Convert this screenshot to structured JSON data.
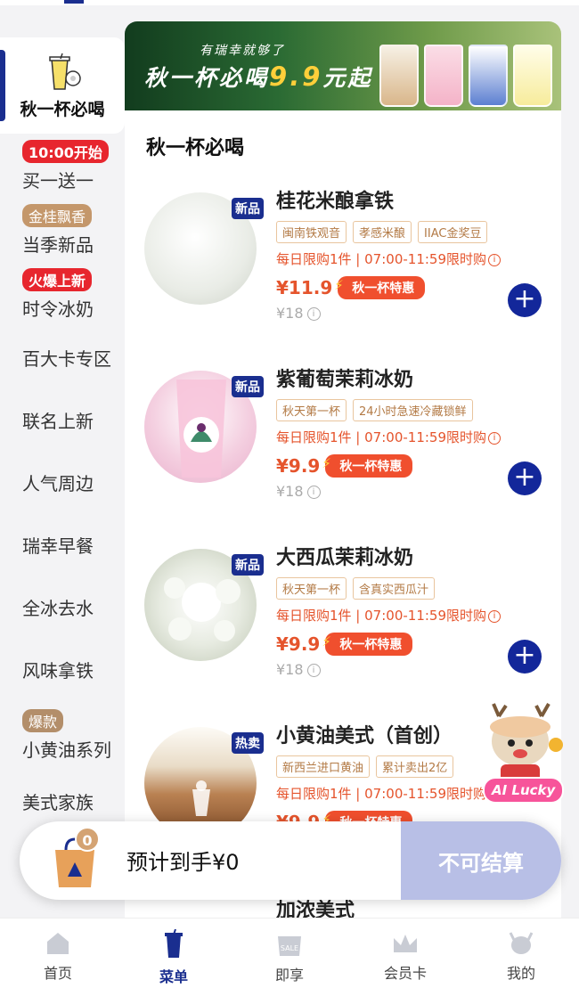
{
  "sidebar": {
    "items": [
      {
        "label": "秋一杯必喝",
        "badge": "",
        "active": true
      },
      {
        "label": "买一送一",
        "badge": "10:00开始",
        "badge_color": "#e7262e"
      },
      {
        "label": "当季新品",
        "badge": "金桂飘香",
        "badge_color": "#c4976b"
      },
      {
        "label": "时令冰奶",
        "badge": "火爆上新",
        "badge_color": "#e7262e"
      },
      {
        "label": "百大卡专区",
        "badge": ""
      },
      {
        "label": "联名上新",
        "badge": ""
      },
      {
        "label": "人气周边",
        "badge": ""
      },
      {
        "label": "瑞幸早餐",
        "badge": ""
      },
      {
        "label": "全冰去水",
        "badge": ""
      },
      {
        "label": "风味拿铁",
        "badge": ""
      },
      {
        "label": "小黄油系列",
        "badge": "爆款",
        "badge_color": "#b38e6a"
      },
      {
        "label": "美式家族",
        "badge": ""
      }
    ]
  },
  "banner": {
    "sub": "有瑞幸就够了",
    "main_prefix": "秋一杯必喝",
    "price": "9.9",
    "main_suffix": "元起"
  },
  "section_title": "秋一杯必喝",
  "products": [
    {
      "tag": "新品",
      "name": "桂花米酿拿铁",
      "chips": [
        "闽南铁观音",
        "孝感米酿",
        "IIAC金奖豆"
      ],
      "limit": "每日限购1件 | 07:00-11:59限时购",
      "price": "¥11.9",
      "promo": "秋一杯特惠",
      "orig": "¥18",
      "img_color": "#e9ece6"
    },
    {
      "tag": "新品",
      "name": "紫葡萄茉莉冰奶",
      "chips": [
        "秋天第一杯",
        "24小时急速冷藏锁鲜"
      ],
      "limit": "每日限购1件 | 07:00-11:59限时购",
      "price": "¥9.9",
      "promo": "秋一杯特惠",
      "orig": "¥18",
      "img_color": "#f4cfe0"
    },
    {
      "tag": "新品",
      "name": "大西瓜茉莉冰奶",
      "chips": [
        "秋天第一杯",
        "含真实西瓜汁"
      ],
      "limit": "每日限购1件 | 07:00-11:59限时购",
      "price": "¥9.9",
      "promo": "秋一杯特惠",
      "orig": "¥18",
      "img_color": "#e3e7dc"
    },
    {
      "tag": "热卖",
      "name": "小黄油美式（首创）",
      "chips": [
        "新西兰进口黄油",
        "累计卖出2亿"
      ],
      "limit": "每日限购1件 | 07:00-11:59限时购",
      "price": "¥9.9",
      "promo": "秋一杯特惠",
      "orig": "",
      "img_color": "#b98152"
    }
  ],
  "next_product_name": "加浓美式",
  "mascot": {
    "label": "AI Lucky"
  },
  "cart": {
    "count": "0",
    "estimate": "预计到手¥0",
    "checkout": "不可结算"
  },
  "nav": {
    "items": [
      {
        "label": "首页",
        "icon": "home-icon"
      },
      {
        "label": "菜单",
        "icon": "menu-cup-icon",
        "active": true
      },
      {
        "label": "即享",
        "icon": "sale-bag-icon"
      },
      {
        "label": "会员卡",
        "icon": "crown-icon"
      },
      {
        "label": "我的",
        "icon": "deer-icon"
      }
    ]
  },
  "colors": {
    "brand": "#1a2e8f",
    "accent": "#e5542c",
    "checkout_disabled": "#b8bfe6"
  }
}
